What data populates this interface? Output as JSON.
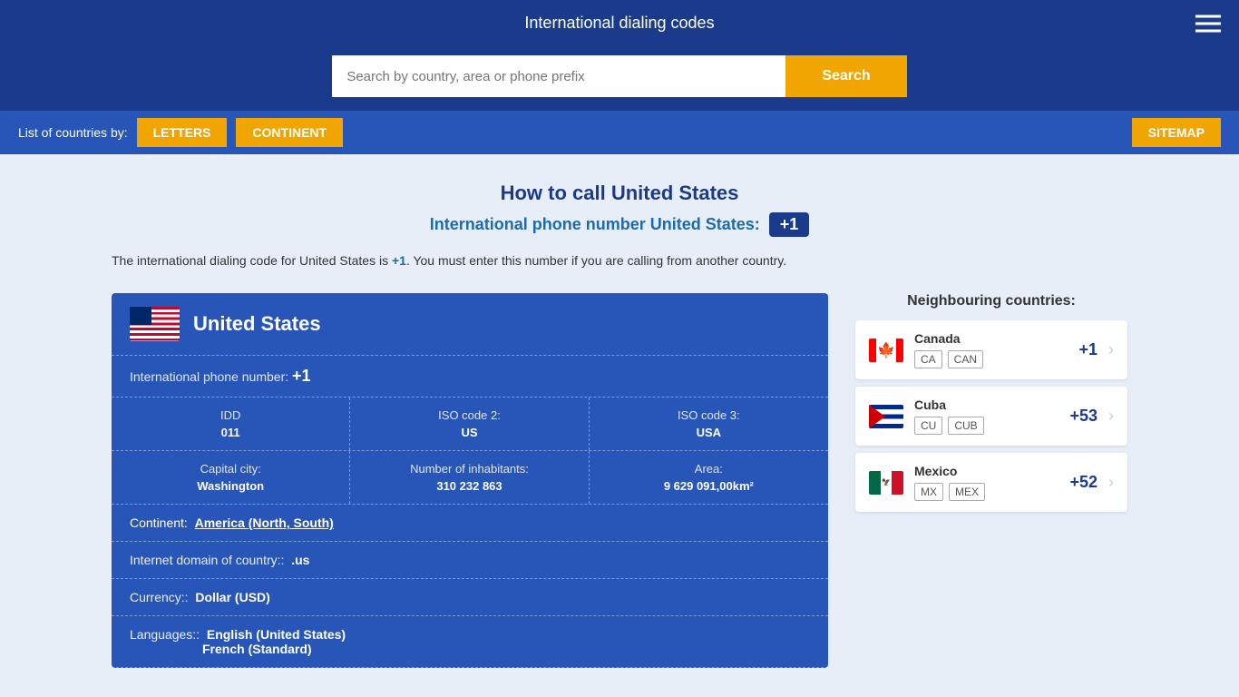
{
  "header": {
    "title": "International dialing codes"
  },
  "search": {
    "placeholder": "Search by country, area or phone prefix",
    "button_label": "Search"
  },
  "nav": {
    "list_label": "List of countries by:",
    "letters_btn": "LETTERS",
    "continent_btn": "CONTINENT",
    "sitemap_btn": "SITEMAP"
  },
  "page": {
    "title": "How to call United States",
    "subtitle_prefix": "International phone number United States:",
    "dial_code": "+1",
    "description": "The international dialing code for United States is +1. You must enter this number if you are calling from another country."
  },
  "country": {
    "name": "United States",
    "international_phone_label": "International phone number:",
    "international_phone_value": "+1",
    "idd_label": "IDD",
    "idd_value": "011",
    "iso2_label": "ISO code 2:",
    "iso2_value": "US",
    "iso3_label": "ISO code 3:",
    "iso3_value": "USA",
    "capital_label": "Capital city:",
    "capital_value": "Washington",
    "inhabitants_label": "Number of inhabitants:",
    "inhabitants_value": "310 232 863",
    "area_label": "Area:",
    "area_value": "9 629 091,00km²",
    "continent_label": "Continent:",
    "continent_value": "America (North, South)",
    "internet_label": "Internet domain of country::",
    "internet_value": ".us",
    "currency_label": "Currency::",
    "currency_value": "Dollar (USD)",
    "languages_label": "Languages::",
    "languages_values": [
      "English (United States)",
      "French (Standard)"
    ]
  },
  "neighbours": {
    "title": "Neighbouring countries:",
    "items": [
      {
        "name": "Canada",
        "code2": "CA",
        "code3": "CAN",
        "dial": "+1",
        "flag": "canada"
      },
      {
        "name": "Cuba",
        "code2": "CU",
        "code3": "CUB",
        "dial": "+53",
        "flag": "cuba"
      },
      {
        "name": "Mexico",
        "code2": "MX",
        "code3": "MEX",
        "dial": "+52",
        "flag": "mexico"
      }
    ]
  }
}
